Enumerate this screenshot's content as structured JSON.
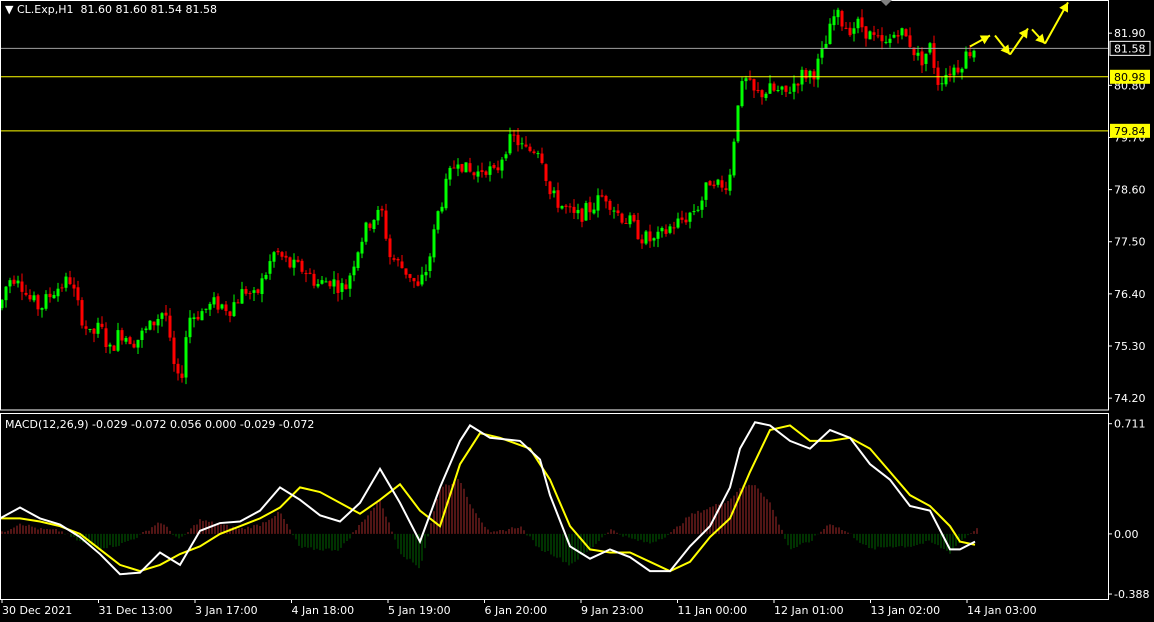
{
  "header": {
    "symbol": "CL.Exp,H1",
    "ohlc": "81.60 81.60 81.54 81.58"
  },
  "macd_header": {
    "label": "MACD(12,26,9) -0.029 -0.072 0.056 0.000 -0.029 -0.072"
  },
  "colors": {
    "background": "#000000",
    "bull": "#00ff00",
    "bear": "#ff0000",
    "level_line": "#ffff00",
    "macd_line": "#ffffff",
    "signal_line": "#ffff00",
    "hist_pos": "#a52a2a",
    "hist_neg": "#006400",
    "arrow": "#ffff00"
  },
  "chart_data": [
    {
      "type": "candlestick",
      "price_ticks": [
        "81.90",
        "80.80",
        "79.70",
        "78.60",
        "77.50",
        "76.40",
        "75.30",
        "74.20"
      ],
      "price_tick_values": [
        81.9,
        80.8,
        79.7,
        78.6,
        77.5,
        76.4,
        75.3,
        74.2
      ],
      "ylim": [
        73.95,
        82.6
      ],
      "current_price": {
        "label": "81.58",
        "value": 81.58
      },
      "levels": [
        {
          "label": "80.98",
          "value": 80.98
        },
        {
          "label": "79.84",
          "value": 79.84
        }
      ],
      "time_labels": [
        "30 Dec 2021",
        "31 Dec 13:00",
        "3 Jan 17:00",
        "4 Jan 18:00",
        "5 Jan 19:00",
        "6 Jan 20:00",
        "9 Jan 23:00",
        "11 Jan 00:00",
        "12 Jan 01:00",
        "13 Jan 02:00",
        "14 Jan 03:00"
      ],
      "close_path": [
        [
          0,
          76.1
        ],
        [
          8,
          76.7
        ],
        [
          18,
          76.8
        ],
        [
          28,
          76.3
        ],
        [
          40,
          76.1
        ],
        [
          55,
          76.5
        ],
        [
          70,
          76.7
        ],
        [
          80,
          76.0
        ],
        [
          90,
          75.5
        ],
        [
          100,
          75.7
        ],
        [
          110,
          75.2
        ],
        [
          120,
          75.6
        ],
        [
          135,
          75.4
        ],
        [
          150,
          75.7
        ],
        [
          165,
          76.1
        ],
        [
          172,
          75.0
        ],
        [
          180,
          74.4
        ],
        [
          188,
          75.9
        ],
        [
          200,
          76.0
        ],
        [
          215,
          76.2
        ],
        [
          230,
          76.1
        ],
        [
          245,
          76.5
        ],
        [
          255,
          76.3
        ],
        [
          265,
          76.8
        ],
        [
          275,
          77.3
        ],
        [
          290,
          77.0
        ],
        [
          305,
          76.9
        ],
        [
          318,
          76.6
        ],
        [
          330,
          76.7
        ],
        [
          345,
          76.5
        ],
        [
          360,
          77.5
        ],
        [
          372,
          78.0
        ],
        [
          382,
          78.1
        ],
        [
          390,
          77.2
        ],
        [
          400,
          77.0
        ],
        [
          410,
          76.8
        ],
        [
          418,
          76.5
        ],
        [
          428,
          77.0
        ],
        [
          438,
          78.1
        ],
        [
          448,
          78.8
        ],
        [
          458,
          79.3
        ],
        [
          466,
          79.0
        ],
        [
          475,
          78.9
        ],
        [
          485,
          79.1
        ],
        [
          495,
          78.9
        ],
        [
          505,
          79.5
        ],
        [
          515,
          79.7
        ],
        [
          525,
          79.4
        ],
        [
          540,
          79.5
        ],
        [
          550,
          78.5
        ],
        [
          560,
          78.3
        ],
        [
          575,
          78.0
        ],
        [
          590,
          78.2
        ],
        [
          605,
          78.5
        ],
        [
          618,
          78.1
        ],
        [
          630,
          77.9
        ],
        [
          642,
          77.6
        ],
        [
          655,
          77.5
        ],
        [
          670,
          77.8
        ],
        [
          685,
          78.0
        ],
        [
          700,
          78.3
        ],
        [
          712,
          78.9
        ],
        [
          722,
          78.6
        ],
        [
          730,
          78.9
        ],
        [
          738,
          80.5
        ],
        [
          745,
          80.9
        ],
        [
          755,
          80.6
        ],
        [
          770,
          80.7
        ],
        [
          785,
          80.6
        ],
        [
          800,
          81.0
        ],
        [
          815,
          81.1
        ],
        [
          825,
          81.6
        ],
        [
          835,
          82.3
        ],
        [
          848,
          82.0
        ],
        [
          860,
          82.1
        ],
        [
          872,
          81.8
        ],
        [
          885,
          81.6
        ],
        [
          898,
          82.0
        ],
        [
          910,
          81.7
        ],
        [
          920,
          81.3
        ],
        [
          930,
          81.6
        ],
        [
          938,
          80.9
        ],
        [
          948,
          81.1
        ],
        [
          958,
          81.2
        ],
        [
          968,
          81.5
        ],
        [
          975,
          81.6
        ]
      ],
      "forecast_arrows": [
        [
          [
            970,
            81.62
          ],
          [
            990,
            81.85
          ]
        ],
        [
          [
            995,
            81.85
          ],
          [
            1010,
            81.45
          ]
        ],
        [
          [
            1010,
            81.45
          ],
          [
            1028,
            82.0
          ]
        ],
        [
          [
            1032,
            81.98
          ],
          [
            1045,
            81.68
          ]
        ],
        [
          [
            1045,
            81.68
          ],
          [
            1068,
            82.55
          ]
        ]
      ]
    },
    {
      "type": "macd",
      "ticks": [
        "0.711",
        "0.00",
        "-0.388"
      ],
      "tick_values": [
        0.711,
        0.0,
        -0.388
      ],
      "ylim": [
        -0.42,
        0.78
      ],
      "macd": [
        [
          0,
          0.1
        ],
        [
          20,
          0.17
        ],
        [
          40,
          0.1
        ],
        [
          60,
          0.06
        ],
        [
          80,
          -0.02
        ],
        [
          100,
          -0.13
        ],
        [
          120,
          -0.26
        ],
        [
          140,
          -0.25
        ],
        [
          160,
          -0.12
        ],
        [
          180,
          -0.2
        ],
        [
          200,
          0.02
        ],
        [
          220,
          0.07
        ],
        [
          240,
          0.08
        ],
        [
          260,
          0.15
        ],
        [
          280,
          0.3
        ],
        [
          300,
          0.22
        ],
        [
          320,
          0.12
        ],
        [
          340,
          0.08
        ],
        [
          360,
          0.2
        ],
        [
          380,
          0.42
        ],
        [
          400,
          0.2
        ],
        [
          420,
          -0.05
        ],
        [
          440,
          0.3
        ],
        [
          460,
          0.6
        ],
        [
          470,
          0.7
        ],
        [
          490,
          0.62
        ],
        [
          520,
          0.6
        ],
        [
          540,
          0.48
        ],
        [
          550,
          0.25
        ],
        [
          570,
          -0.08
        ],
        [
          590,
          -0.16
        ],
        [
          610,
          -0.1
        ],
        [
          630,
          -0.15
        ],
        [
          650,
          -0.24
        ],
        [
          670,
          -0.24
        ],
        [
          690,
          -0.08
        ],
        [
          710,
          0.05
        ],
        [
          730,
          0.3
        ],
        [
          740,
          0.55
        ],
        [
          755,
          0.72
        ],
        [
          770,
          0.7
        ],
        [
          790,
          0.6
        ],
        [
          810,
          0.55
        ],
        [
          830,
          0.67
        ],
        [
          850,
          0.62
        ],
        [
          870,
          0.45
        ],
        [
          890,
          0.35
        ],
        [
          910,
          0.18
        ],
        [
          930,
          0.15
        ],
        [
          950,
          -0.1
        ],
        [
          960,
          -0.1
        ],
        [
          975,
          -0.05
        ]
      ],
      "signal": [
        [
          0,
          0.1
        ],
        [
          20,
          0.1
        ],
        [
          40,
          0.08
        ],
        [
          60,
          0.05
        ],
        [
          80,
          0.0
        ],
        [
          100,
          -0.1
        ],
        [
          120,
          -0.2
        ],
        [
          140,
          -0.24
        ],
        [
          160,
          -0.2
        ],
        [
          180,
          -0.13
        ],
        [
          200,
          -0.08
        ],
        [
          220,
          0.0
        ],
        [
          240,
          0.05
        ],
        [
          260,
          0.1
        ],
        [
          280,
          0.17
        ],
        [
          300,
          0.3
        ],
        [
          320,
          0.27
        ],
        [
          340,
          0.2
        ],
        [
          360,
          0.13
        ],
        [
          380,
          0.22
        ],
        [
          400,
          0.32
        ],
        [
          420,
          0.15
        ],
        [
          440,
          0.05
        ],
        [
          460,
          0.45
        ],
        [
          480,
          0.65
        ],
        [
          500,
          0.62
        ],
        [
          530,
          0.55
        ],
        [
          550,
          0.35
        ],
        [
          570,
          0.05
        ],
        [
          590,
          -0.1
        ],
        [
          610,
          -0.12
        ],
        [
          630,
          -0.12
        ],
        [
          650,
          -0.18
        ],
        [
          670,
          -0.24
        ],
        [
          690,
          -0.18
        ],
        [
          710,
          -0.02
        ],
        [
          730,
          0.1
        ],
        [
          750,
          0.4
        ],
        [
          770,
          0.67
        ],
        [
          790,
          0.7
        ],
        [
          810,
          0.6
        ],
        [
          830,
          0.6
        ],
        [
          850,
          0.62
        ],
        [
          870,
          0.55
        ],
        [
          890,
          0.4
        ],
        [
          910,
          0.25
        ],
        [
          930,
          0.18
        ],
        [
          950,
          0.05
        ],
        [
          960,
          -0.05
        ],
        [
          975,
          -0.07
        ]
      ],
      "histogram": [
        [
          0,
          0.0
        ],
        [
          20,
          0.07
        ],
        [
          40,
          0.03
        ],
        [
          60,
          0.02
        ],
        [
          80,
          -0.05
        ],
        [
          100,
          -0.09
        ],
        [
          120,
          -0.07
        ],
        [
          140,
          -0.01
        ],
        [
          160,
          0.08
        ],
        [
          180,
          -0.04
        ],
        [
          200,
          0.09
        ],
        [
          220,
          0.06
        ],
        [
          240,
          0.03
        ],
        [
          260,
          0.06
        ],
        [
          280,
          0.14
        ],
        [
          300,
          -0.09
        ],
        [
          320,
          -0.1
        ],
        [
          340,
          -0.1
        ],
        [
          360,
          0.06
        ],
        [
          380,
          0.22
        ],
        [
          400,
          -0.12
        ],
        [
          420,
          -0.22
        ],
        [
          440,
          0.3
        ],
        [
          460,
          0.35
        ],
        [
          470,
          0.2
        ],
        [
          490,
          0.0
        ],
        [
          520,
          0.05
        ],
        [
          540,
          -0.1
        ],
        [
          550,
          -0.12
        ],
        [
          570,
          -0.2
        ],
        [
          590,
          -0.1
        ],
        [
          610,
          0.03
        ],
        [
          630,
          -0.03
        ],
        [
          650,
          -0.06
        ],
        [
          670,
          0.0
        ],
        [
          690,
          0.12
        ],
        [
          710,
          0.17
        ],
        [
          730,
          0.22
        ],
        [
          740,
          0.3
        ],
        [
          755,
          0.32
        ],
        [
          770,
          0.2
        ],
        [
          790,
          -0.1
        ],
        [
          810,
          -0.05
        ],
        [
          830,
          0.07
        ],
        [
          850,
          0.0
        ],
        [
          870,
          -0.1
        ],
        [
          890,
          -0.08
        ],
        [
          910,
          -0.08
        ],
        [
          930,
          -0.05
        ],
        [
          950,
          -0.12
        ],
        [
          960,
          -0.05
        ],
        [
          975,
          0.03
        ]
      ]
    }
  ]
}
